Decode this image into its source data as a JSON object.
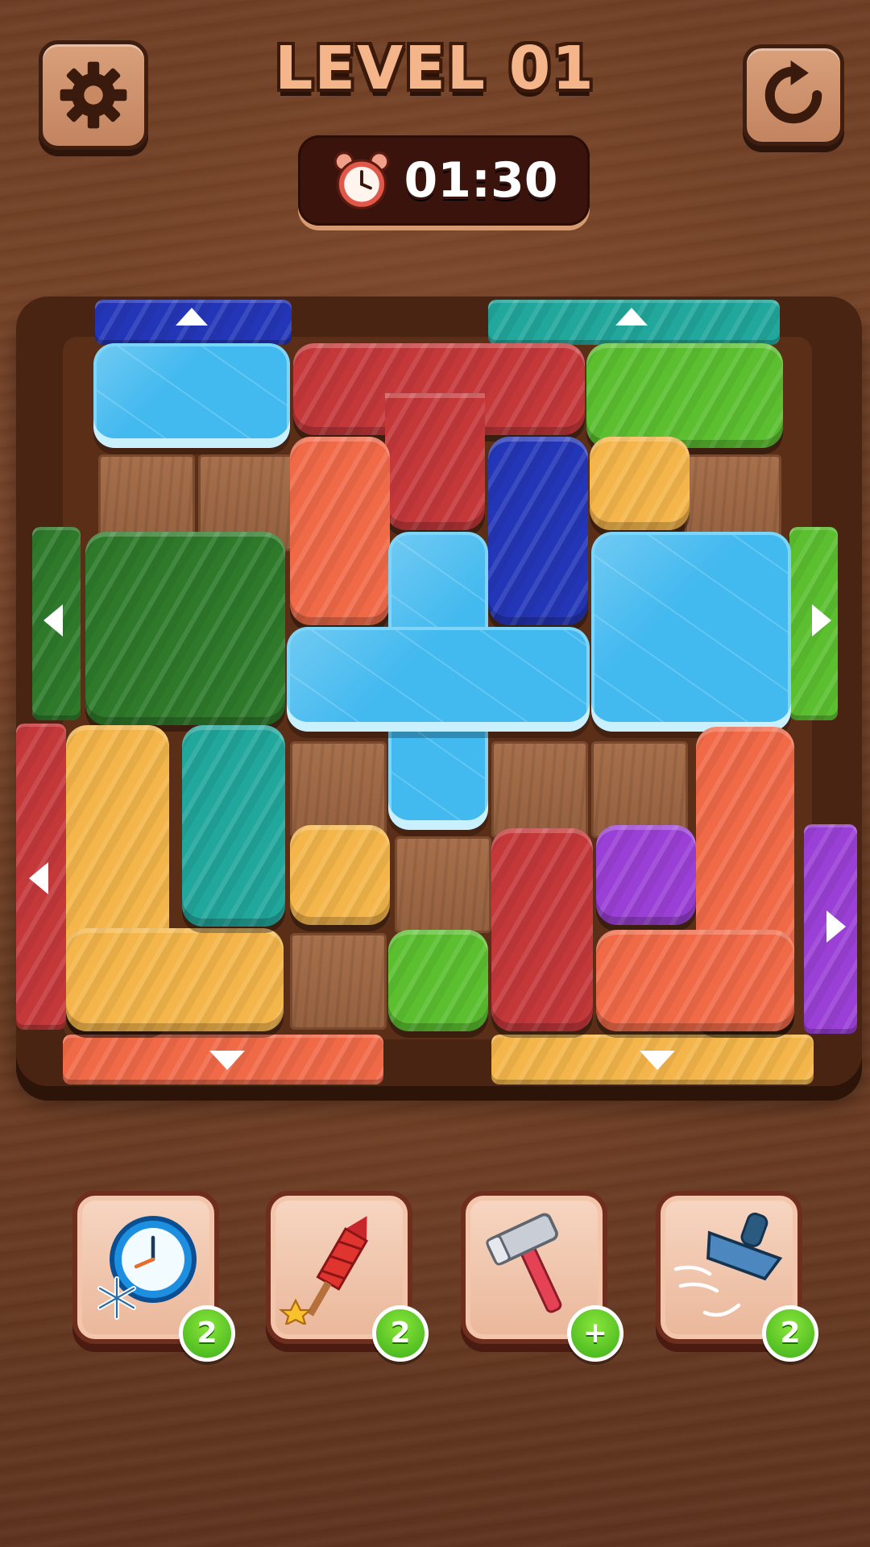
{
  "header": {
    "settings_icon": "gear-icon",
    "title": "LEVEL 01",
    "restart_icon": "restart-icon"
  },
  "timer": {
    "icon": "alarm-clock-icon",
    "value": "01:30"
  },
  "board": {
    "exits": [
      {
        "side": "top",
        "color": "#2436b8",
        "arrow": "up"
      },
      {
        "side": "top",
        "color": "#22a79c",
        "arrow": "up"
      },
      {
        "side": "left",
        "color": "#2e7a2a",
        "arrow": "left"
      },
      {
        "side": "right",
        "color": "#5bbf30",
        "arrow": "right"
      },
      {
        "side": "left",
        "color": "#c5383a",
        "arrow": "left"
      },
      {
        "side": "right",
        "color": "#9b40d6",
        "arrow": "right"
      },
      {
        "side": "bottom",
        "color": "#f06a48",
        "arrow": "down"
      },
      {
        "side": "bottom",
        "color": "#f4b64a",
        "arrow": "down"
      }
    ],
    "blocks": [
      {
        "color": "ice",
        "frozen": true
      },
      {
        "color": "#c5383a"
      },
      {
        "color": "#5bbf30"
      },
      {
        "color": "#f06a48"
      },
      {
        "color": "#2436b8"
      },
      {
        "color": "#f4b64a"
      },
      {
        "color": "#2e7a2a"
      },
      {
        "color": "ice",
        "frozen": true
      },
      {
        "color": "ice",
        "frozen": true
      },
      {
        "color": "#f4b64a"
      },
      {
        "color": "#22a79c"
      },
      {
        "color": "#f4b64a"
      },
      {
        "color": "#c5383a"
      },
      {
        "color": "#9b40d6"
      },
      {
        "color": "#f06a48"
      },
      {
        "color": "#5bbf30"
      }
    ]
  },
  "boosters": [
    {
      "name": "freeze-time",
      "icon": "freeze-clock-icon",
      "count": "2"
    },
    {
      "name": "rocket",
      "icon": "rocket-icon",
      "count": "2"
    },
    {
      "name": "hammer",
      "icon": "hammer-icon",
      "count": "+"
    },
    {
      "name": "vacuum",
      "icon": "vacuum-icon",
      "count": "2"
    }
  ]
}
